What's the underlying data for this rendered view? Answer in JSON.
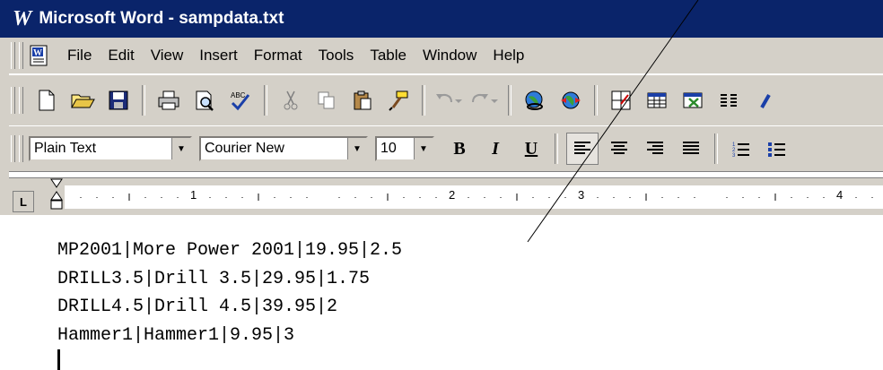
{
  "window": {
    "app_letter": "W",
    "title": "Microsoft Word - sampdata.txt"
  },
  "menubar": {
    "items": [
      "File",
      "Edit",
      "View",
      "Insert",
      "Format",
      "Tools",
      "Table",
      "Window",
      "Help"
    ]
  },
  "standard_toolbar": {
    "icons": [
      "new-document-icon",
      "open-folder-icon",
      "save-icon",
      "print-icon",
      "print-preview-icon",
      "spelling-icon",
      "cut-icon",
      "copy-icon",
      "paste-icon",
      "format-painter-icon",
      "undo-icon",
      "redo-icon",
      "insert-hyperlink-icon",
      "web-toolbar-icon",
      "tables-borders-icon",
      "insert-table-icon",
      "insert-excel-icon",
      "columns-icon"
    ]
  },
  "format_toolbar": {
    "style": "Plain Text",
    "font": "Courier New",
    "size": "10",
    "bold_label": "B",
    "italic_label": "I",
    "underline_label": "U"
  },
  "ruler": {
    "tab_selector": "L",
    "numbers": [
      "1",
      "2",
      "3",
      "4"
    ]
  },
  "document": {
    "lines": [
      "MP2001|More Power 2001|19.95|2.5",
      "DRILL3.5|Drill 3.5|29.95|1.75",
      "DRILL4.5|Drill 4.5|39.95|2",
      "Hammer1|Hammer1|9.95|3"
    ]
  }
}
